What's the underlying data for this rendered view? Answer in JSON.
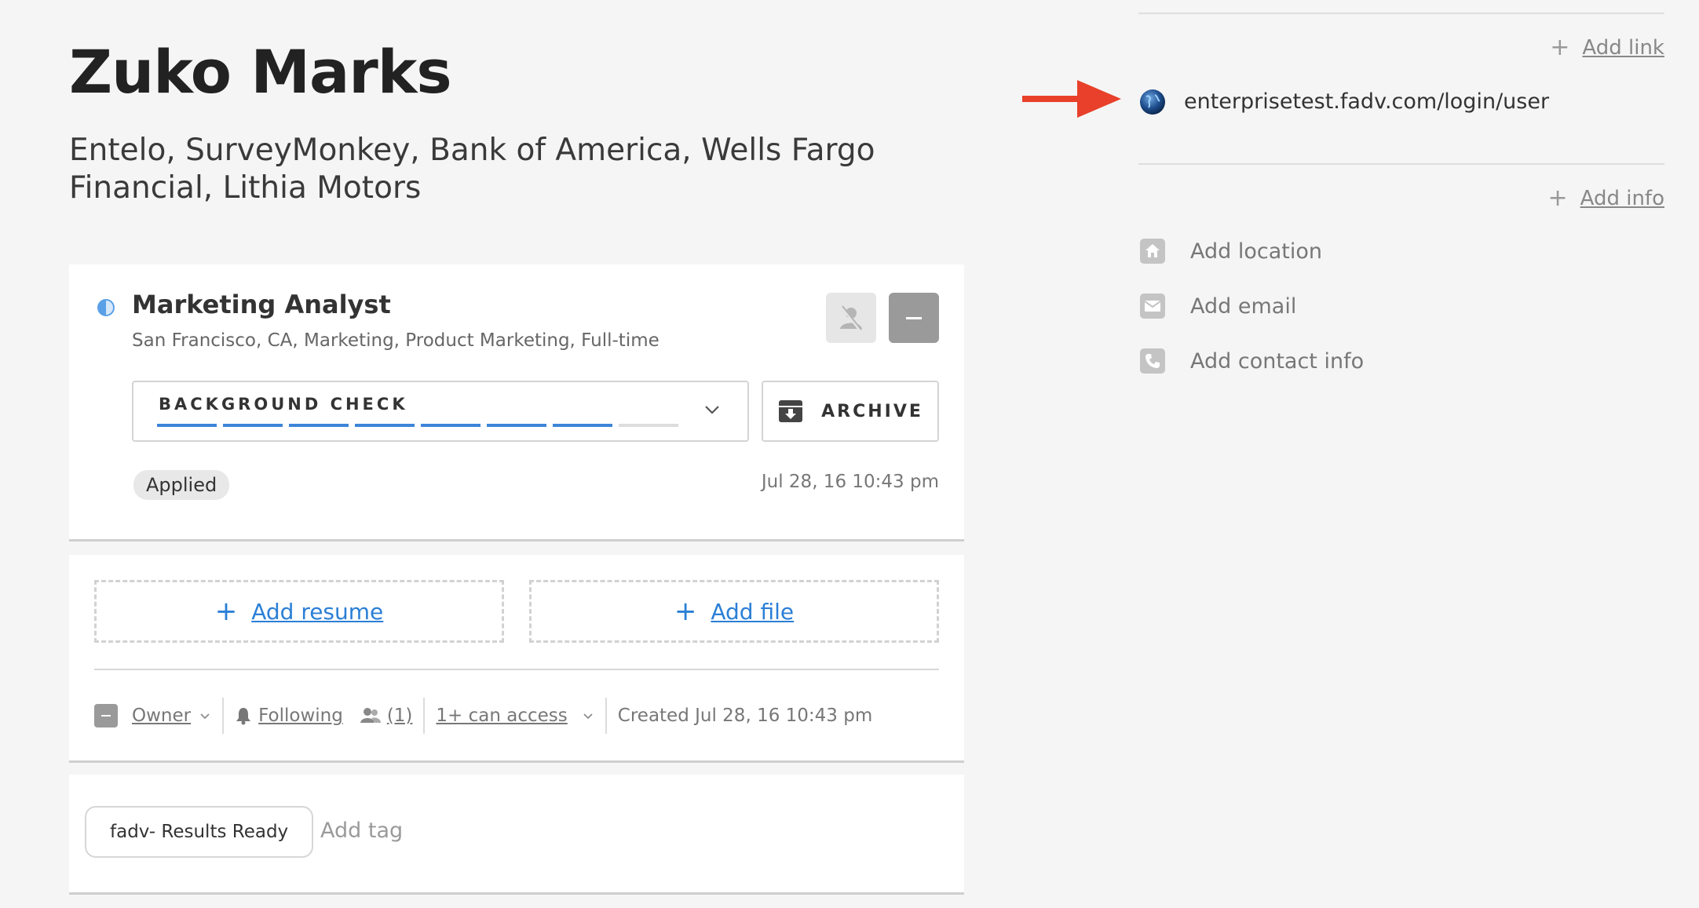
{
  "candidate": {
    "name": "Zuko Marks",
    "companies": "Entelo, SurveyMonkey, Bank of America, Wells Fargo Financial, Lithia Motors"
  },
  "opportunity": {
    "job_title": "Marketing Analyst",
    "job_meta": "San Francisco, CA, Marketing, Product Marketing, Full-time",
    "stage_label": "BACKGROUND CHECK",
    "stage_progress": {
      "completed": 7,
      "total": 8
    },
    "archive_label": "ARCHIVE",
    "status_badge": "Applied",
    "applied_date": "Jul 28, 16 10:43 pm"
  },
  "files": {
    "add_resume": "Add resume",
    "add_file": "Add file"
  },
  "meta": {
    "owner": "Owner",
    "following": "Following",
    "followers_count": "(1)",
    "access": "1+ can access",
    "created": "Created Jul 28, 16 10:43 pm"
  },
  "tags": {
    "items": [
      "fadv- Results Ready"
    ],
    "add_placeholder": "Add tag"
  },
  "sidebar": {
    "add_link": "Add link",
    "link_url": "enterprisetest.fadv.com/login/user",
    "add_info": "Add info",
    "info_items": [
      "Add location",
      "Add email",
      "Add contact info"
    ]
  },
  "colors": {
    "accent_blue": "#2b7fd6",
    "stage_done": "#3d85d8",
    "stage_pending": "#dddddd",
    "annotation_arrow": "#e8402a"
  },
  "icons": [
    "anonymize-icon",
    "owner-avatar-icon",
    "chevron-down-icon",
    "archive-box-icon",
    "bell-icon",
    "people-icon",
    "globe-icon",
    "home-icon",
    "envelope-icon",
    "phone-icon",
    "plus-icon",
    "red-arrow-annotation"
  ]
}
